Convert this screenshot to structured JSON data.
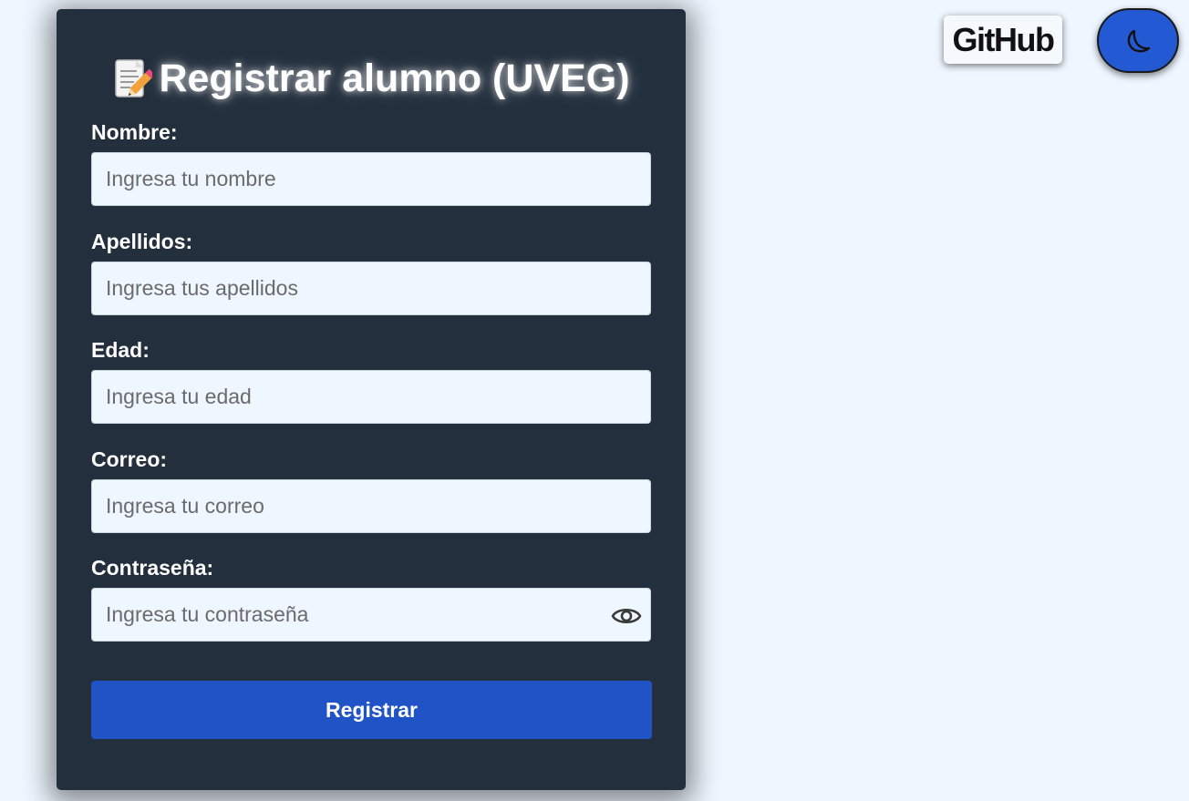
{
  "header": {
    "github_label": "GitHub",
    "theme_toggle_icon": "moon-icon"
  },
  "form": {
    "title": "Registrar alumno (UVEG)",
    "title_icon": "memo-icon",
    "fields": [
      {
        "label": "Nombre:",
        "placeholder": "Ingresa tu nombre",
        "value": ""
      },
      {
        "label": "Apellidos:",
        "placeholder": "Ingresa tus apellidos",
        "value": ""
      },
      {
        "label": "Edad:",
        "placeholder": "Ingresa tu edad",
        "value": ""
      },
      {
        "label": "Correo:",
        "placeholder": "Ingresa tu correo",
        "value": ""
      },
      {
        "label": "Contraseña:",
        "placeholder": "Ingresa tu contraseña",
        "value": ""
      }
    ],
    "password_toggle_icon": "eye-icon",
    "submit_label": "Registrar"
  },
  "colors": {
    "page_background": "#eef6ff",
    "card_background": "#232f3d",
    "accent": "#1f53c6",
    "input_background": "#eef6ff"
  }
}
